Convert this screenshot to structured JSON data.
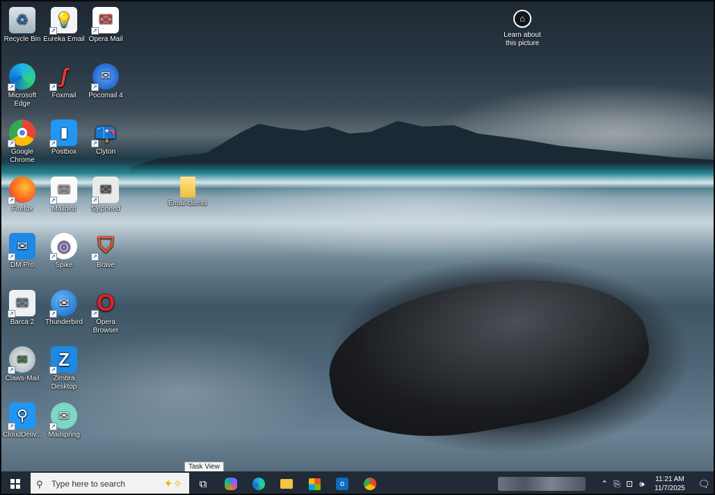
{
  "desktop_icons": [
    {
      "label": "Recycle Bin"
    },
    {
      "label": "Eureka Email"
    },
    {
      "label": "Opera Mail"
    },
    {
      "label": "Microsoft Edge"
    },
    {
      "label": "Foxmail"
    },
    {
      "label": "Pocomail 4"
    },
    {
      "label": "Google Chrome"
    },
    {
      "label": "Postbox"
    },
    {
      "label": "Clyton"
    },
    {
      "label": "Firefox"
    },
    {
      "label": "Mailbird"
    },
    {
      "label": "Sylpheed"
    },
    {
      "label": "DM Pro"
    },
    {
      "label": "Spike"
    },
    {
      "label": "Brave"
    },
    {
      "label": "Barca 2"
    },
    {
      "label": "Thunderbird"
    },
    {
      "label": "Opera Browser"
    },
    {
      "label": "Claws-Mail"
    },
    {
      "label": "Zimbra Desktop"
    },
    {
      "label": "CloudDeliv..."
    },
    {
      "label": "Mailspring"
    },
    {
      "label": "Email clients"
    }
  ],
  "learn_about": {
    "line1": "Learn about",
    "line2": "this picture"
  },
  "tooltip": {
    "text": "Task View"
  },
  "taskbar": {
    "search_placeholder": "Type here to search",
    "apps": [
      "task-view",
      "copilot",
      "edge",
      "file-explorer",
      "microsoft-store",
      "outlook",
      "chrome"
    ],
    "time": "11:21 AM",
    "date": "11/7/2025"
  },
  "colors": {
    "taskbar": "#202b37",
    "search_bg": "#f2f2f2",
    "accent": "#8ab4f8"
  }
}
